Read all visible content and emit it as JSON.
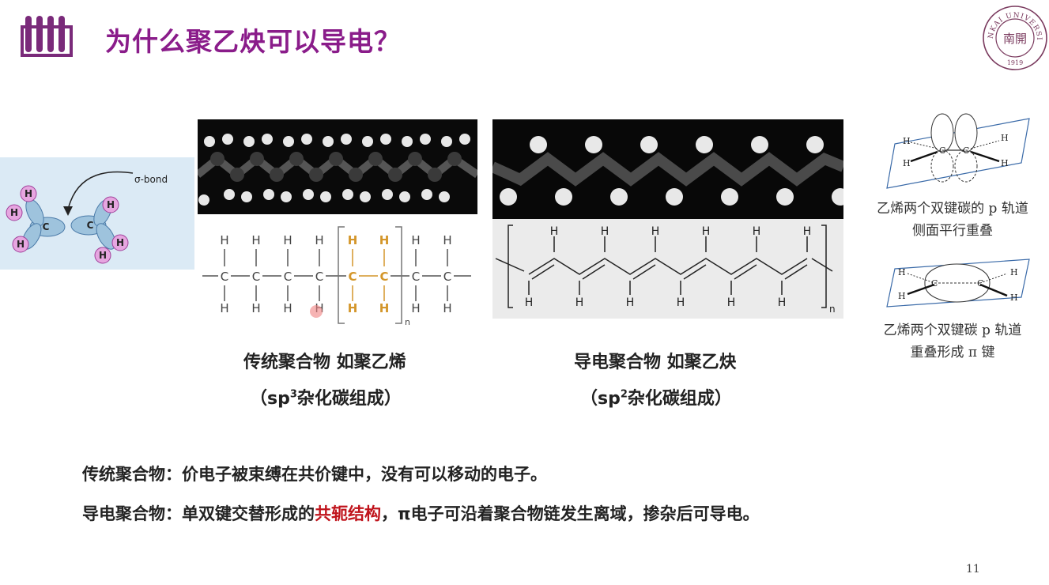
{
  "slide": {
    "title": "为什么聚乙炔可以导电？",
    "page_number": "11"
  },
  "seal": {
    "arc_text": "NANKAI UNIVERSITY",
    "center_text": "南開",
    "year": "1919"
  },
  "sigma_figure": {
    "bond_label": "σ-bond",
    "carbon_label": "C",
    "hydrogen_label": "H"
  },
  "polyethylene": {
    "caption": "传统聚合物 如聚乙烯",
    "subcaption_prefix": "（sp",
    "subcaption_sup": "3",
    "subcaption_suffix": "杂化碳组成）",
    "atom_h": "H",
    "atom_c": "C",
    "repeat_n": "n"
  },
  "polyacetylene": {
    "caption": "导电聚合物 如聚乙炔",
    "subcaption_prefix": "（sp",
    "subcaption_sup": "2",
    "subcaption_suffix": "杂化碳组成）",
    "atom_h": "H",
    "atom_c": "C",
    "repeat_n": "n"
  },
  "side_figures": {
    "top_caption_line1": "乙烯两个双键碳的 p 轨道",
    "top_caption_line2": "侧面平行重叠",
    "bottom_caption_line1": "乙烯两个双键碳 p 轨道",
    "bottom_caption_line2": "重叠形成 π 键",
    "atom_h": "H",
    "atom_c": "C"
  },
  "statements": {
    "line1": "传统聚合物：价电子被束缚在共价键中，没有可以移动的电子。",
    "line2_a": "导电聚合物：单双键交替形成的",
    "line2_highlight": "共轭结构",
    "line2_b": "，π电子可沿着聚合物链发生离域，掺杂后可导电。"
  },
  "colors": {
    "title": "#8a1c8a",
    "highlight": "#c0141c",
    "repeat_unit": "#d4962a",
    "seal": "#7a3a5e"
  }
}
